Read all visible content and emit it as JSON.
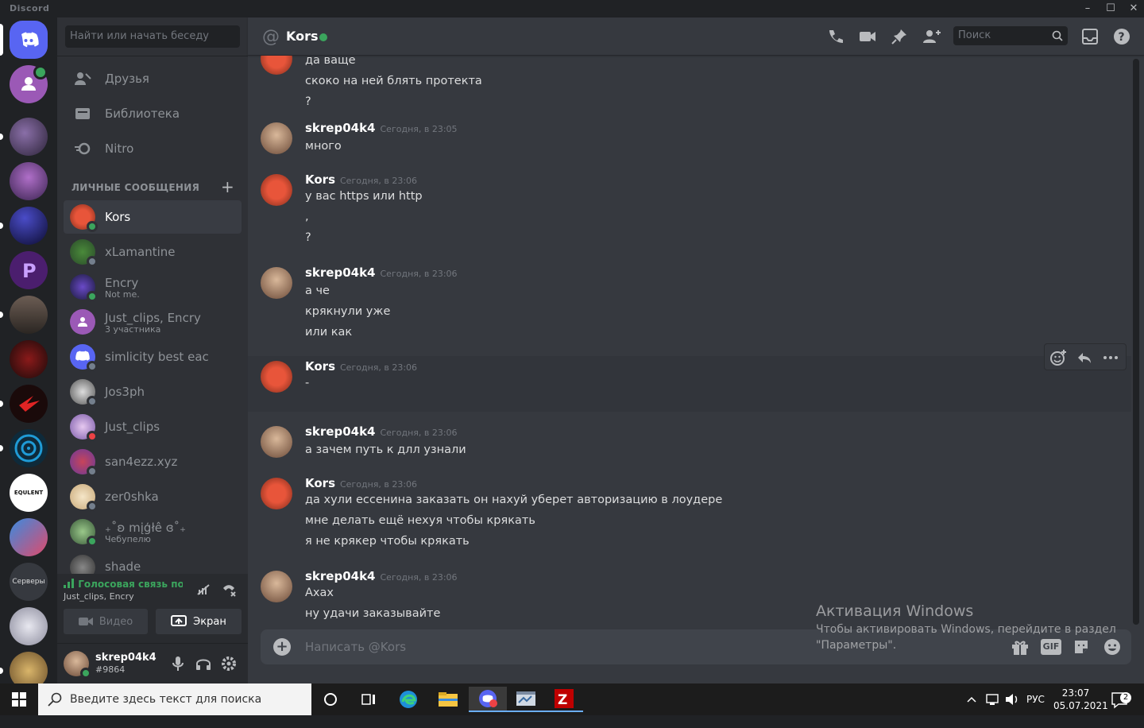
{
  "window": {
    "app_name": "Discord",
    "controls": {
      "minimize": "–",
      "maximize": "☐",
      "close": "✕"
    }
  },
  "guilds": [
    {
      "name": "home",
      "icon": "discord-logo-icon"
    },
    {
      "name": "group-dm-voice",
      "icon": "group-icon"
    },
    {
      "name": "server-1",
      "icon": "server-icon"
    },
    {
      "name": "server-2",
      "icon": "server-icon"
    },
    {
      "name": "server-3",
      "icon": "server-icon"
    },
    {
      "name": "server-4",
      "icon": "server-icon"
    },
    {
      "name": "server-rust",
      "icon": "server-icon"
    },
    {
      "name": "server-6",
      "icon": "server-icon"
    },
    {
      "name": "server-7",
      "icon": "server-icon"
    },
    {
      "name": "server-8",
      "icon": "server-icon"
    },
    {
      "name": "equlent",
      "label": "EQULENT"
    },
    {
      "name": "server-10",
      "icon": "server-icon"
    },
    {
      "name": "servers-folder",
      "label": "Серверы"
    },
    {
      "name": "server-12",
      "icon": "server-icon"
    },
    {
      "name": "server-13",
      "icon": "server-icon"
    }
  ],
  "sidebar": {
    "search_placeholder": "Найти или начать беседу",
    "nav": [
      {
        "label": "Друзья",
        "icon": "friends-icon"
      },
      {
        "label": "Библиотека",
        "icon": "library-icon"
      },
      {
        "label": "Nitro",
        "icon": "nitro-icon"
      }
    ],
    "dm_header": "ЛИЧНЫЕ СООБЩЕНИЯ",
    "dm_add": "+",
    "dms": [
      {
        "name": "Kors",
        "sub": "",
        "status": "online"
      },
      {
        "name": "xLamantine",
        "sub": "",
        "status": "offline"
      },
      {
        "name": "Encry",
        "sub": "Not me.",
        "status": "online"
      },
      {
        "name": "Just_clips, Encry",
        "sub": "3 участника",
        "status": ""
      },
      {
        "name": "simlicity best eac",
        "sub": "",
        "status": "offline"
      },
      {
        "name": "Jos3ph",
        "sub": "",
        "status": "offline"
      },
      {
        "name": "Just_clips",
        "sub": "",
        "status": "dnd"
      },
      {
        "name": "san4ezz.xyz",
        "sub": "",
        "status": "offline"
      },
      {
        "name": "zer0shka",
        "sub": "",
        "status": "offline"
      },
      {
        "name": "₊˚ʚ mįģłê ɞ˚₊",
        "sub": "Чебупелю",
        "status": "online"
      },
      {
        "name": "shade",
        "sub": "",
        "status": ""
      }
    ],
    "voice": {
      "status": "Голосовая связь подк",
      "channel": "Just_clips, Encry",
      "video_label": "Видео",
      "screen_label": "Экран"
    },
    "user": {
      "name": "skrep04k4",
      "tag": "#9864"
    }
  },
  "chat": {
    "title": "Kors",
    "at": "@",
    "search_placeholder": "Поиск",
    "composer_placeholder": "Написать @Kors",
    "messages": [
      {
        "author": "",
        "time": "",
        "lines": [
          "да ваще",
          "скоко на ней блять протекта",
          "?"
        ]
      },
      {
        "author": "skrep04k4",
        "time": "Сегодня, в 23:05",
        "lines": [
          "много"
        ]
      },
      {
        "author": "Kors",
        "time": "Сегодня, в 23:06",
        "lines": [
          "у вас https или http",
          ",",
          "?"
        ]
      },
      {
        "author": "skrep04k4",
        "time": "Сегодня, в 23:06",
        "lines": [
          "а че",
          "крякнули уже",
          "или как"
        ]
      },
      {
        "author": "Kors",
        "time": "Сегодня, в 23:06",
        "lines": [
          "-"
        ]
      },
      {
        "author": "skrep04k4",
        "time": "Сегодня, в 23:06",
        "lines": [
          "а зачем путь к длл узнали"
        ]
      },
      {
        "author": "Kors",
        "time": "Сегодня, в 23:06",
        "lines": [
          "да хули ессенина заказать он нахуй уберет авторизацию в лоудере",
          "мне делать ещё нехуя чтобы крякать",
          "я не крякер чтобы крякать"
        ]
      },
      {
        "author": "skrep04k4",
        "time": "Сегодня, в 23:06",
        "lines": [
          "Ахах",
          "ну удачи заказывайте"
        ]
      }
    ]
  },
  "watermark": {
    "title": "Активация Windows",
    "line1": "Чтобы активировать Windows, перейдите в раздел",
    "line2": "\"Параметры\"."
  },
  "taskbar": {
    "search_placeholder": "Введите здесь текст для поиска",
    "lang": "РУС",
    "time": "23:07",
    "date": "05.07.2021",
    "notifications": "2"
  }
}
